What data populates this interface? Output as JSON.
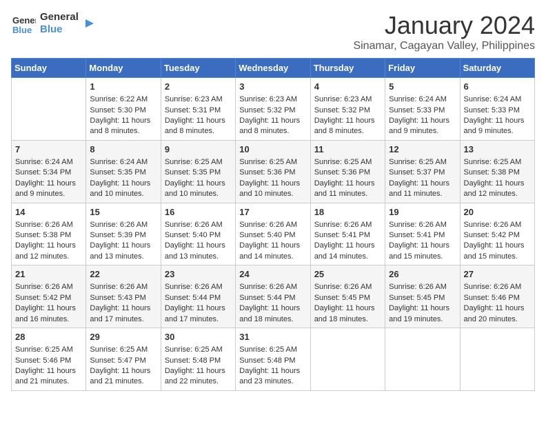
{
  "logo": {
    "line1": "General",
    "line2": "Blue"
  },
  "title": "January 2024",
  "location": "Sinamar, Cagayan Valley, Philippines",
  "headers": [
    "Sunday",
    "Monday",
    "Tuesday",
    "Wednesday",
    "Thursday",
    "Friday",
    "Saturday"
  ],
  "weeks": [
    [
      {
        "day": "",
        "content": ""
      },
      {
        "day": "1",
        "content": "Sunrise: 6:22 AM\nSunset: 5:30 PM\nDaylight: 11 hours\nand 8 minutes."
      },
      {
        "day": "2",
        "content": "Sunrise: 6:23 AM\nSunset: 5:31 PM\nDaylight: 11 hours\nand 8 minutes."
      },
      {
        "day": "3",
        "content": "Sunrise: 6:23 AM\nSunset: 5:32 PM\nDaylight: 11 hours\nand 8 minutes."
      },
      {
        "day": "4",
        "content": "Sunrise: 6:23 AM\nSunset: 5:32 PM\nDaylight: 11 hours\nand 8 minutes."
      },
      {
        "day": "5",
        "content": "Sunrise: 6:24 AM\nSunset: 5:33 PM\nDaylight: 11 hours\nand 9 minutes."
      },
      {
        "day": "6",
        "content": "Sunrise: 6:24 AM\nSunset: 5:33 PM\nDaylight: 11 hours\nand 9 minutes."
      }
    ],
    [
      {
        "day": "7",
        "content": "Sunrise: 6:24 AM\nSunset: 5:34 PM\nDaylight: 11 hours\nand 9 minutes."
      },
      {
        "day": "8",
        "content": "Sunrise: 6:24 AM\nSunset: 5:35 PM\nDaylight: 11 hours\nand 10 minutes."
      },
      {
        "day": "9",
        "content": "Sunrise: 6:25 AM\nSunset: 5:35 PM\nDaylight: 11 hours\nand 10 minutes."
      },
      {
        "day": "10",
        "content": "Sunrise: 6:25 AM\nSunset: 5:36 PM\nDaylight: 11 hours\nand 10 minutes."
      },
      {
        "day": "11",
        "content": "Sunrise: 6:25 AM\nSunset: 5:36 PM\nDaylight: 11 hours\nand 11 minutes."
      },
      {
        "day": "12",
        "content": "Sunrise: 6:25 AM\nSunset: 5:37 PM\nDaylight: 11 hours\nand 11 minutes."
      },
      {
        "day": "13",
        "content": "Sunrise: 6:25 AM\nSunset: 5:38 PM\nDaylight: 11 hours\nand 12 minutes."
      }
    ],
    [
      {
        "day": "14",
        "content": "Sunrise: 6:26 AM\nSunset: 5:38 PM\nDaylight: 11 hours\nand 12 minutes."
      },
      {
        "day": "15",
        "content": "Sunrise: 6:26 AM\nSunset: 5:39 PM\nDaylight: 11 hours\nand 13 minutes."
      },
      {
        "day": "16",
        "content": "Sunrise: 6:26 AM\nSunset: 5:40 PM\nDaylight: 11 hours\nand 13 minutes."
      },
      {
        "day": "17",
        "content": "Sunrise: 6:26 AM\nSunset: 5:40 PM\nDaylight: 11 hours\nand 14 minutes."
      },
      {
        "day": "18",
        "content": "Sunrise: 6:26 AM\nSunset: 5:41 PM\nDaylight: 11 hours\nand 14 minutes."
      },
      {
        "day": "19",
        "content": "Sunrise: 6:26 AM\nSunset: 5:41 PM\nDaylight: 11 hours\nand 15 minutes."
      },
      {
        "day": "20",
        "content": "Sunrise: 6:26 AM\nSunset: 5:42 PM\nDaylight: 11 hours\nand 15 minutes."
      }
    ],
    [
      {
        "day": "21",
        "content": "Sunrise: 6:26 AM\nSunset: 5:42 PM\nDaylight: 11 hours\nand 16 minutes."
      },
      {
        "day": "22",
        "content": "Sunrise: 6:26 AM\nSunset: 5:43 PM\nDaylight: 11 hours\nand 17 minutes."
      },
      {
        "day": "23",
        "content": "Sunrise: 6:26 AM\nSunset: 5:44 PM\nDaylight: 11 hours\nand 17 minutes."
      },
      {
        "day": "24",
        "content": "Sunrise: 6:26 AM\nSunset: 5:44 PM\nDaylight: 11 hours\nand 18 minutes."
      },
      {
        "day": "25",
        "content": "Sunrise: 6:26 AM\nSunset: 5:45 PM\nDaylight: 11 hours\nand 18 minutes."
      },
      {
        "day": "26",
        "content": "Sunrise: 6:26 AM\nSunset: 5:45 PM\nDaylight: 11 hours\nand 19 minutes."
      },
      {
        "day": "27",
        "content": "Sunrise: 6:26 AM\nSunset: 5:46 PM\nDaylight: 11 hours\nand 20 minutes."
      }
    ],
    [
      {
        "day": "28",
        "content": "Sunrise: 6:25 AM\nSunset: 5:46 PM\nDaylight: 11 hours\nand 21 minutes."
      },
      {
        "day": "29",
        "content": "Sunrise: 6:25 AM\nSunset: 5:47 PM\nDaylight: 11 hours\nand 21 minutes."
      },
      {
        "day": "30",
        "content": "Sunrise: 6:25 AM\nSunset: 5:48 PM\nDaylight: 11 hours\nand 22 minutes."
      },
      {
        "day": "31",
        "content": "Sunrise: 6:25 AM\nSunset: 5:48 PM\nDaylight: 11 hours\nand 23 minutes."
      },
      {
        "day": "",
        "content": ""
      },
      {
        "day": "",
        "content": ""
      },
      {
        "day": "",
        "content": ""
      }
    ]
  ]
}
